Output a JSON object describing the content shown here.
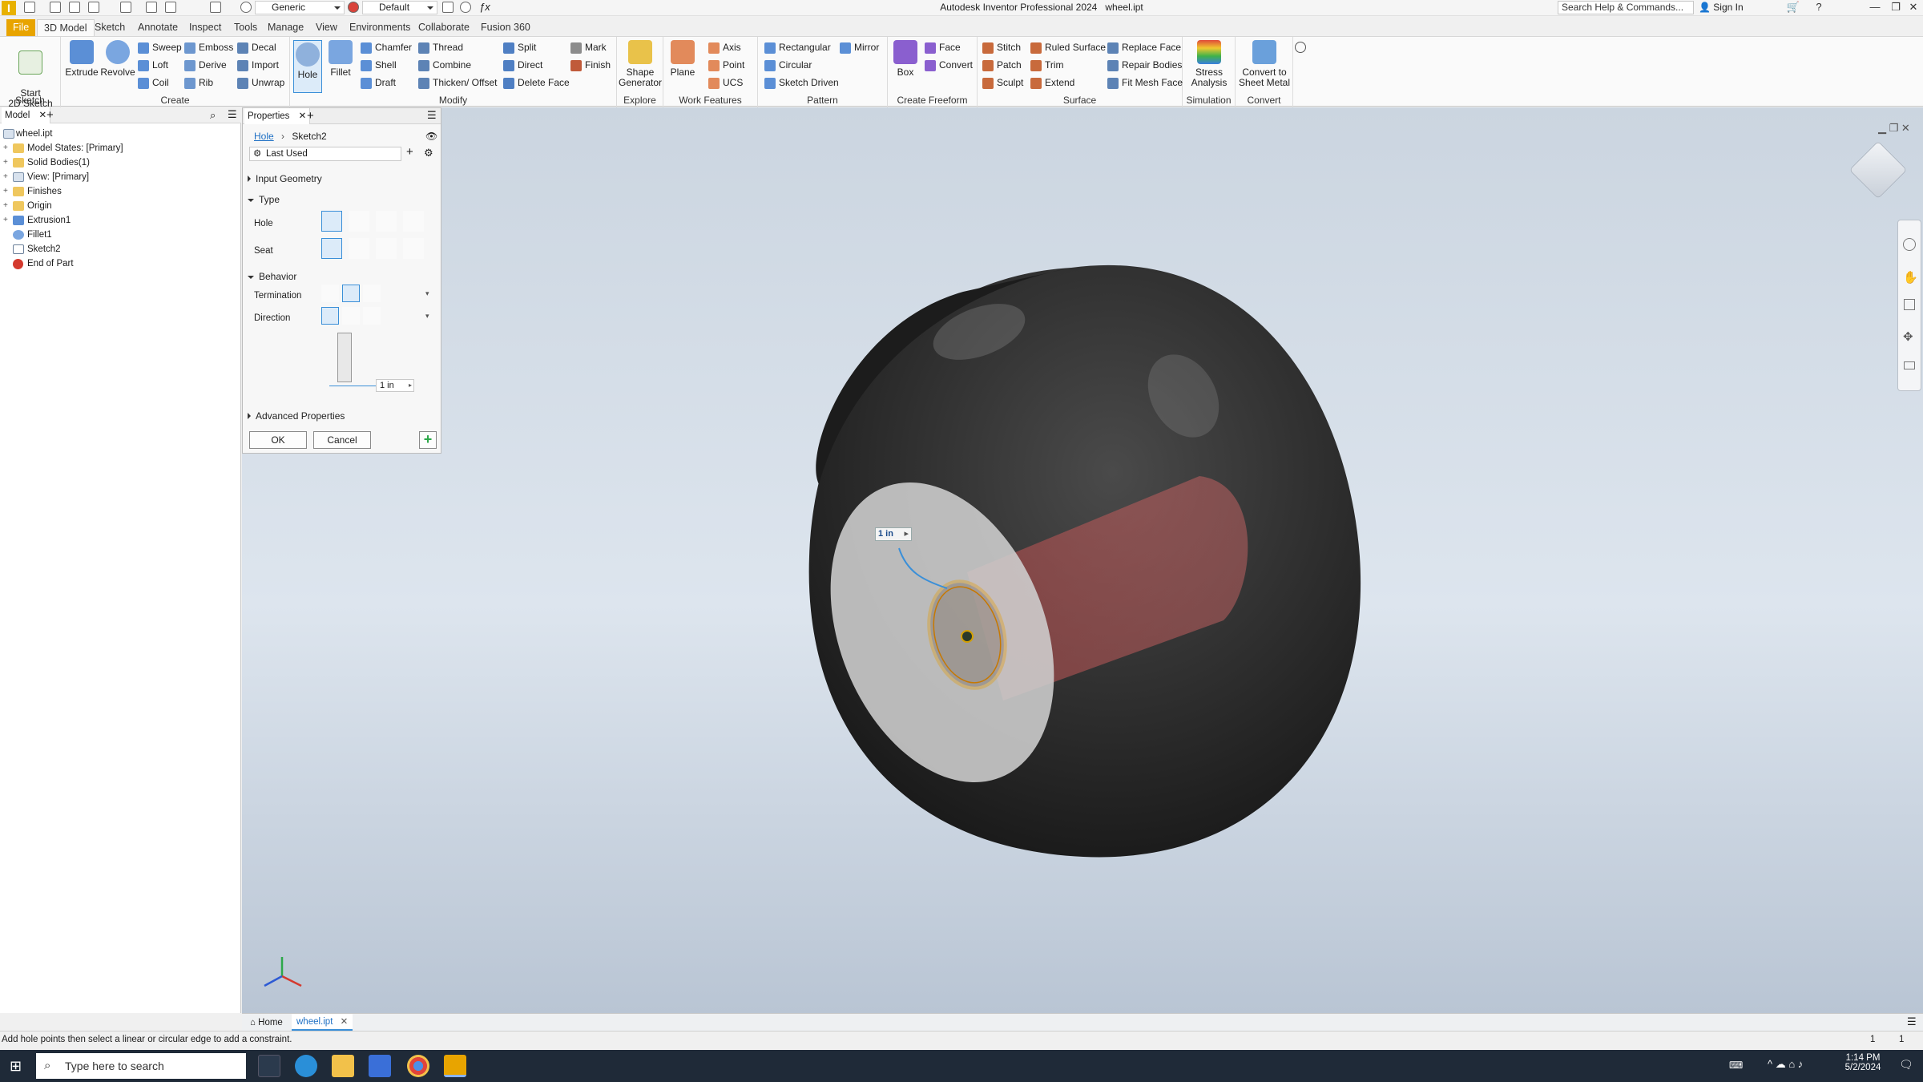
{
  "window": {
    "app_title": "Autodesk Inventor Professional 2024",
    "doc_title": "wheel.ipt",
    "material": "Generic",
    "appearance": "Default",
    "search_placeholder": "Search Help & Commands...",
    "sign_in": "Sign In"
  },
  "tabs": [
    "File",
    "3D Model",
    "Sketch",
    "Annotate",
    "Inspect",
    "Tools",
    "Manage",
    "View",
    "Environments",
    "Collaborate",
    "Fusion 360"
  ],
  "ribbon": {
    "sketch": {
      "label": "Sketch",
      "start": "Start\n2D Sketch"
    },
    "create": {
      "label": "Create",
      "extrude": "Extrude",
      "revolve": "Revolve",
      "sweep": "Sweep",
      "loft": "Loft",
      "coil": "Coil",
      "emboss": "Emboss",
      "derive": "Derive",
      "rib": "Rib",
      "decal": "Decal",
      "import": "Import",
      "unwrap": "Unwrap"
    },
    "modify": {
      "label": "Modify",
      "hole": "Hole",
      "fillet": "Fillet",
      "chamfer": "Chamfer",
      "shell": "Shell",
      "draft": "Draft",
      "thread": "Thread",
      "combine": "Combine",
      "thicken": "Thicken/ Offset",
      "split": "Split",
      "direct": "Direct",
      "delete_face": "Delete Face",
      "mark": "Mark",
      "finish": "Finish"
    },
    "explore": {
      "label": "Explore",
      "shape_gen": "Shape\nGenerator"
    },
    "work": {
      "label": "Work Features",
      "plane": "Plane",
      "axis": "Axis",
      "point": "Point",
      "ucs": "UCS"
    },
    "pattern": {
      "label": "Pattern",
      "rectangular": "Rectangular",
      "circular": "Circular",
      "sketch_driven": "Sketch Driven",
      "mirror": "Mirror"
    },
    "freeform": {
      "label": "Create Freeform",
      "box": "Box",
      "face": "Face",
      "convert": "Convert"
    },
    "surface": {
      "label": "Surface",
      "stitch": "Stitch",
      "patch": "Patch",
      "sculpt": "Sculpt",
      "ruled": "Ruled Surface",
      "trim": "Trim",
      "extend": "Extend",
      "replace": "Replace Face",
      "repair": "Repair Bodies",
      "fitmesh": "Fit Mesh Face"
    },
    "simulation": {
      "label": "Simulation",
      "stress": "Stress\nAnalysis"
    },
    "convert": {
      "label": "Convert",
      "sheetmetal": "Convert to\nSheet Metal"
    }
  },
  "browser": {
    "tab": "Model",
    "items": [
      "wheel.ipt",
      "Model States: [Primary]",
      "Solid Bodies(1)",
      "View: [Primary]",
      "Finishes",
      "Origin",
      "Extrusion1",
      "Fillet1",
      "Sketch2",
      "End of Part"
    ]
  },
  "properties": {
    "tab": "Properties",
    "breadcrumb_link": "Hole",
    "breadcrumb_item": "Sketch2",
    "preset": "Last Used",
    "input_geometry": "Input Geometry",
    "type": "Type",
    "hole_label": "Hole",
    "seat_label": "Seat",
    "behavior": "Behavior",
    "termination_label": "Termination",
    "direction_label": "Direction",
    "dia_value": "1 in",
    "advanced": "Advanced Properties",
    "ok": "OK",
    "cancel": "Cancel"
  },
  "viewport": {
    "dim_label": "1 in"
  },
  "docbar": {
    "home": "Home",
    "doc": "wheel.ipt"
  },
  "status": {
    "text": "Add hole points then select a linear or circular edge to add a constraint.",
    "n1": "1",
    "n2": "1"
  },
  "taskbar": {
    "search": "Type here to search",
    "time": "1:14 PM",
    "date": "5/2/2024"
  },
  "colors": {
    "accent": "#e8a400",
    "select": "#3a8fd8"
  }
}
